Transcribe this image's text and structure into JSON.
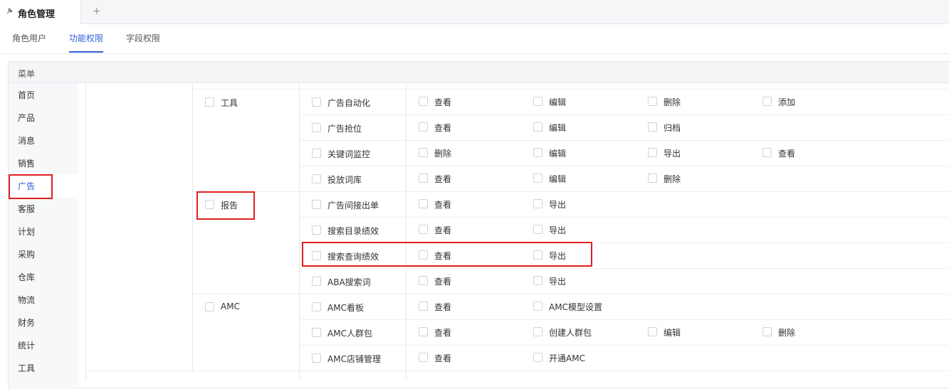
{
  "tabbar": {
    "tab_title": "角色管理",
    "add_label": "+"
  },
  "subtabs": [
    {
      "label": "角色用户",
      "active": false
    },
    {
      "label": "功能权限",
      "active": true
    },
    {
      "label": "字段权限",
      "active": false
    }
  ],
  "panel": {
    "header": "菜单"
  },
  "menu": [
    {
      "label": "首页",
      "active": false
    },
    {
      "label": "产品",
      "active": false
    },
    {
      "label": "消息",
      "active": false
    },
    {
      "label": "销售",
      "active": false
    },
    {
      "label": "广告",
      "active": true
    },
    {
      "label": "客服",
      "active": false
    },
    {
      "label": "计划",
      "active": false
    },
    {
      "label": "采购",
      "active": false
    },
    {
      "label": "仓库",
      "active": false
    },
    {
      "label": "物流",
      "active": false
    },
    {
      "label": "财务",
      "active": false
    },
    {
      "label": "统计",
      "active": false
    },
    {
      "label": "工具",
      "active": false
    }
  ],
  "groups": [
    {
      "label": "工具",
      "rows": [
        {
          "label": "广告自动化",
          "perms": [
            "查看",
            "编辑",
            "删除",
            "添加"
          ]
        },
        {
          "label": "广告抢位",
          "perms": [
            "查看",
            "编辑",
            "归档"
          ]
        },
        {
          "label": "关键词监控",
          "perms": [
            "删除",
            "编辑",
            "导出",
            "查看"
          ]
        },
        {
          "label": "投放词库",
          "perms": [
            "查看",
            "编辑",
            "删除"
          ]
        }
      ]
    },
    {
      "label": "报告",
      "rows": [
        {
          "label": "广告间接出单",
          "perms": [
            "查看",
            "导出"
          ]
        },
        {
          "label": "搜索目录绩效",
          "perms": [
            "查看",
            "导出"
          ]
        },
        {
          "label": "搜索查询绩效",
          "perms": [
            "查看",
            "导出"
          ]
        },
        {
          "label": "ABA搜索词",
          "perms": [
            "查看",
            "导出"
          ]
        }
      ]
    },
    {
      "label": "AMC",
      "rows": [
        {
          "label": "AMC看板",
          "perms": [
            "查看",
            "AMC模型设置"
          ]
        },
        {
          "label": "AMC人群包",
          "perms": [
            "查看",
            "创建人群包",
            "编辑",
            "删除"
          ]
        },
        {
          "label": "AMC店铺管理",
          "perms": [
            "查看",
            "开通AMC"
          ]
        }
      ]
    }
  ],
  "colors": {
    "accent": "#2f5fd8",
    "highlight": "#e02020"
  }
}
